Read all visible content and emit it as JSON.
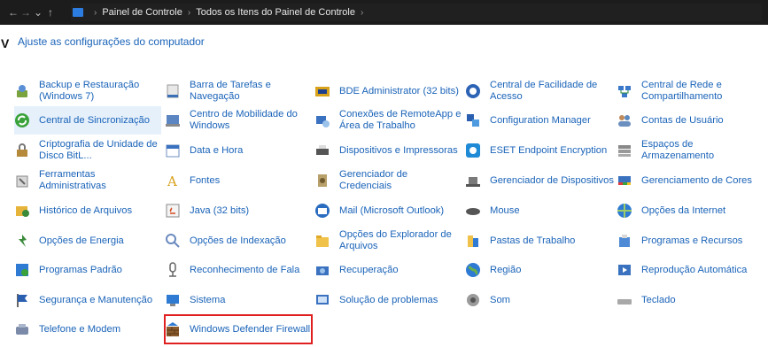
{
  "address_bar": {
    "back_glyph": "←",
    "forward_glyph": "→",
    "dropdown_glyph": "⌄",
    "up_glyph": "↑",
    "crumbs": [
      "Painel de Controle",
      "Todos os Itens do Painel de Controle"
    ],
    "trailing_glyph": "›"
  },
  "page": {
    "title_fragment": "V",
    "adjust_settings": "Ajuste as configurações do computador"
  },
  "items": [
    {
      "id": "backup",
      "label": "Backup e Restauração (Windows 7)",
      "icon": "backup-icon"
    },
    {
      "id": "taskbar",
      "label": "Barra de Tarefas e Navegação",
      "icon": "taskbar-icon"
    },
    {
      "id": "bde",
      "label": "BDE Administrator (32 bits)",
      "icon": "bde-icon"
    },
    {
      "id": "ease",
      "label": "Central de Facilidade de Acesso",
      "icon": "ease-of-access-icon"
    },
    {
      "id": "network",
      "label": "Central de Rede e Compartilhamento",
      "icon": "network-icon"
    },
    {
      "id": "sync",
      "label": "Central de Sincronização",
      "icon": "sync-icon"
    },
    {
      "id": "mobility",
      "label": "Centro de Mobilidade do Windows",
      "icon": "mobility-icon"
    },
    {
      "id": "remoteapp",
      "label": "Conexões de RemoteApp e Área de Trabalho",
      "icon": "remoteapp-icon"
    },
    {
      "id": "configmgr",
      "label": "Configuration Manager",
      "icon": "configuration-manager-icon"
    },
    {
      "id": "users",
      "label": "Contas de Usuário",
      "icon": "user-accounts-icon"
    },
    {
      "id": "bitlocker",
      "label": "Criptografia de Unidade de Disco BitL...",
      "icon": "bitlocker-icon"
    },
    {
      "id": "datetime",
      "label": "Data e Hora",
      "icon": "date-time-icon"
    },
    {
      "id": "devices",
      "label": "Dispositivos e Impressoras",
      "icon": "printer-icon"
    },
    {
      "id": "eset",
      "label": "ESET Endpoint Encryption",
      "icon": "eset-icon"
    },
    {
      "id": "storage",
      "label": "Espaços de Armazenamento",
      "icon": "storage-spaces-icon"
    },
    {
      "id": "admintools",
      "label": "Ferramentas Administrativas",
      "icon": "admin-tools-icon"
    },
    {
      "id": "fonts",
      "label": "Fontes",
      "icon": "fonts-icon"
    },
    {
      "id": "credentials",
      "label": "Gerenciador de Credenciais",
      "icon": "credentials-icon"
    },
    {
      "id": "devmgr",
      "label": "Gerenciador de Dispositivos",
      "icon": "device-manager-icon"
    },
    {
      "id": "colors",
      "label": "Gerenciamento de Cores",
      "icon": "color-management-icon"
    },
    {
      "id": "filehistory",
      "label": "Histórico de Arquivos",
      "icon": "file-history-icon"
    },
    {
      "id": "java",
      "label": "Java (32 bits)",
      "icon": "java-icon"
    },
    {
      "id": "mail",
      "label": "Mail (Microsoft Outlook)",
      "icon": "mail-icon"
    },
    {
      "id": "mouse",
      "label": "Mouse",
      "icon": "mouse-icon"
    },
    {
      "id": "internet",
      "label": "Opções da Internet",
      "icon": "internet-options-icon"
    },
    {
      "id": "power",
      "label": "Opções de Energia",
      "icon": "power-icon"
    },
    {
      "id": "indexing",
      "label": "Opções de Indexação",
      "icon": "indexing-icon"
    },
    {
      "id": "explorer",
      "label": "Opções do Explorador de Arquivos",
      "icon": "folder-options-icon"
    },
    {
      "id": "workfolders",
      "label": "Pastas de Trabalho",
      "icon": "work-folders-icon"
    },
    {
      "id": "programs",
      "label": "Programas e Recursos",
      "icon": "programs-icon"
    },
    {
      "id": "defaultprog",
      "label": "Programas Padrão",
      "icon": "default-programs-icon"
    },
    {
      "id": "speech",
      "label": "Reconhecimento de Fala",
      "icon": "microphone-icon"
    },
    {
      "id": "recovery",
      "label": "Recuperação",
      "icon": "recovery-icon"
    },
    {
      "id": "region",
      "label": "Região",
      "icon": "region-icon"
    },
    {
      "id": "autoplay",
      "label": "Reprodução Automática",
      "icon": "autoplay-icon"
    },
    {
      "id": "security",
      "label": "Segurança e Manutenção",
      "icon": "flag-icon"
    },
    {
      "id": "system",
      "label": "Sistema",
      "icon": "system-icon"
    },
    {
      "id": "troubleshoot",
      "label": "Solução de problemas",
      "icon": "troubleshooting-icon"
    },
    {
      "id": "sound",
      "label": "Som",
      "icon": "speaker-icon"
    },
    {
      "id": "keyboard",
      "label": "Teclado",
      "icon": "keyboard-icon"
    },
    {
      "id": "phone",
      "label": "Telefone e Modem",
      "icon": "phone-modem-icon"
    },
    {
      "id": "firewall",
      "label": "Windows Defender Firewall",
      "icon": "firewall-icon"
    }
  ],
  "colors": {
    "link": "#1a63b8",
    "selected_bg": "#e5f0fb",
    "highlight_outline": "#e02020",
    "address_bg": "#1c1c1c"
  }
}
